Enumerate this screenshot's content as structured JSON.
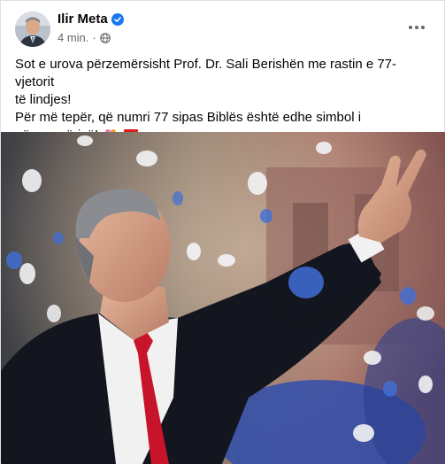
{
  "post": {
    "author": "Ilir Meta",
    "time": "4 min.",
    "separator": "·",
    "text_line1": "Sot e urova përzemërsisht Prof. Dr. Sali Berishën me rastin e 77-vjetorit",
    "text_line2": "të lindjes!",
    "text_line3": "Për më tepër, që numri 77 sipas Biblës është edhe simbol i",
    "text_line4": "përsosmërisë!",
    "icons": [
      "verified-badge-icon",
      "globe-icon",
      "more-options-icon",
      "clover-emoji-icon",
      "albania-flag-emoji-icon"
    ]
  },
  "colors": {
    "verified": "#1877f2",
    "text": "#050505",
    "meta": "#65676b",
    "confetti": "#3f6fd8",
    "flag_red": "#e41e20"
  }
}
